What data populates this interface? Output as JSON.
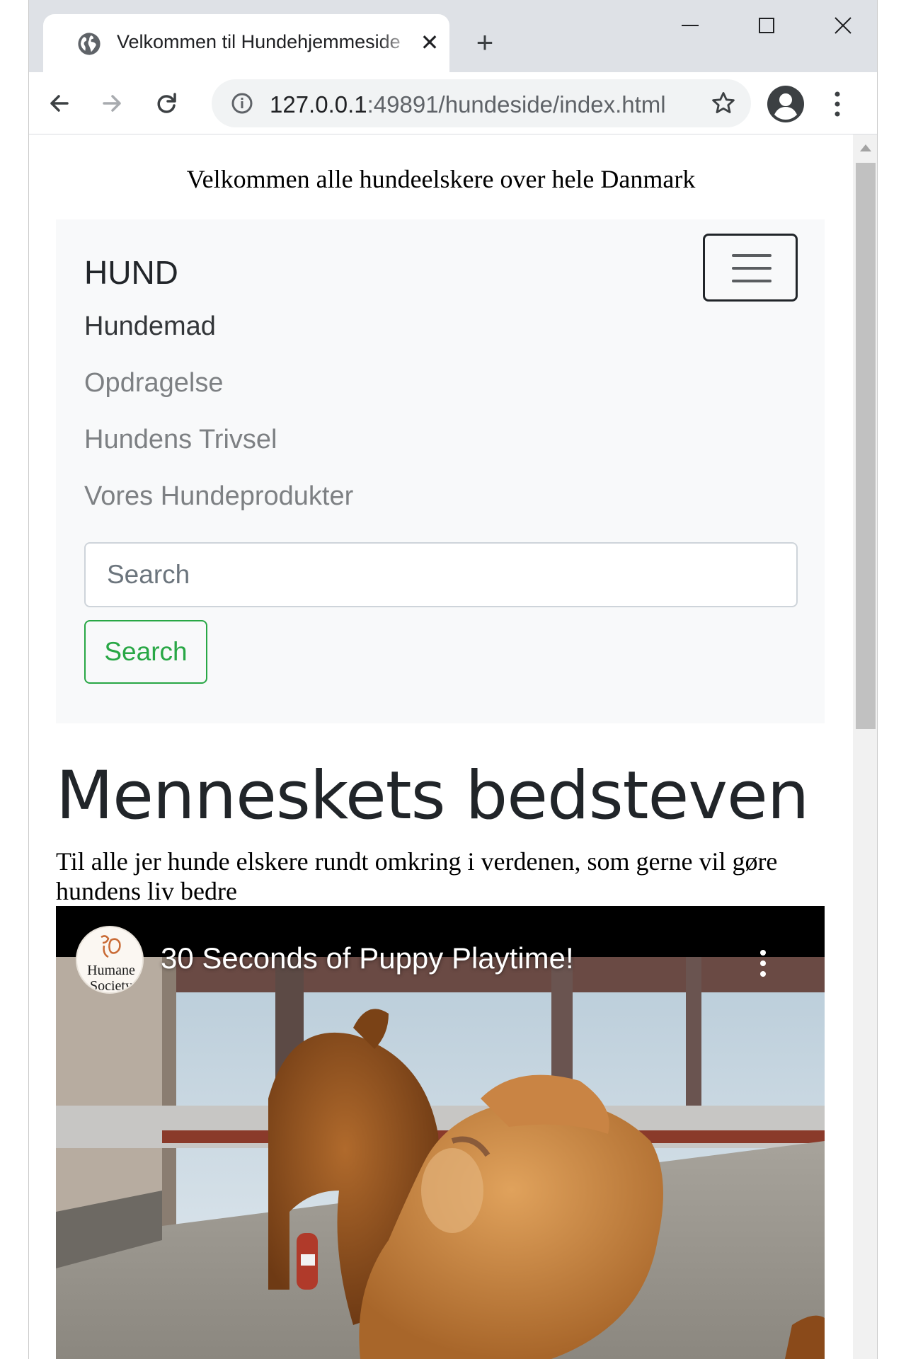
{
  "browser": {
    "tab_title": "Velkommen til Hundehjemmeside",
    "url_host": "127.0.0.1",
    "url_path": ":49891/hundeside/index.html"
  },
  "page": {
    "welcome": "Velkommen alle hundeelskere over hele Danmark",
    "navbar": {
      "brand": "HUND",
      "links": [
        "Hundemad",
        "Opdragelse",
        "Hundens Trivsel",
        "Vores Hundeprodukter"
      ],
      "search_placeholder": "Search",
      "search_button": "Search"
    },
    "heading": "Menneskets bedsteven",
    "lead": "Til alle jer hunde elskere rundt omkring i verdenen, som gerne vil gøre hundens liv bedre",
    "video": {
      "title": "30 Seconds of Puppy Playtime!",
      "channel_logo": "Humane Society"
    }
  },
  "colors": {
    "search_button": "#28a745",
    "navbar_bg": "#f8f9fa",
    "chrome_bg": "#dee1e6"
  }
}
